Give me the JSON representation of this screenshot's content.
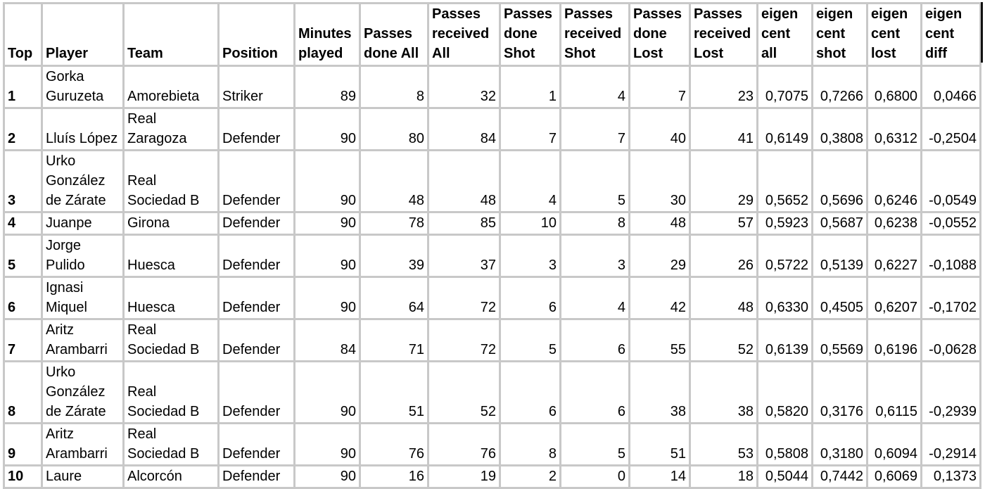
{
  "table": {
    "headers": [
      "Top",
      "Player",
      "Team",
      "Position",
      "Minutes played",
      "Passes done All",
      "Passes received All",
      "Passes done Shot",
      "Passes received Shot",
      "Passes done Lost",
      "Passes received Lost",
      "eigen cent all",
      "eigen cent shot",
      "eigen cent lost",
      "eigen cent diff"
    ],
    "rows": [
      [
        "1",
        "Gorka Guruzeta",
        "Amorebieta",
        "Striker",
        "89",
        "8",
        "32",
        "1",
        "4",
        "7",
        "23",
        "0,7075",
        "0,7266",
        "0,6800",
        "0,0466"
      ],
      [
        "2",
        "Lluís López",
        "Real Zaragoza",
        "Defender",
        "90",
        "80",
        "84",
        "7",
        "7",
        "40",
        "41",
        "0,6149",
        "0,3808",
        "0,6312",
        "-0,2504"
      ],
      [
        "3",
        "Urko González de Zárate",
        "Real Sociedad B",
        "Defender",
        "90",
        "48",
        "48",
        "4",
        "5",
        "30",
        "29",
        "0,5652",
        "0,5696",
        "0,6246",
        "-0,0549"
      ],
      [
        "4",
        "Juanpe",
        "Girona",
        "Defender",
        "90",
        "78",
        "85",
        "10",
        "8",
        "48",
        "57",
        "0,5923",
        "0,5687",
        "0,6238",
        "-0,0552"
      ],
      [
        "5",
        "Jorge Pulido",
        "Huesca",
        "Defender",
        "90",
        "39",
        "37",
        "3",
        "3",
        "29",
        "26",
        "0,5722",
        "0,5139",
        "0,6227",
        "-0,1088"
      ],
      [
        "6",
        "Ignasi Miquel",
        "Huesca",
        "Defender",
        "90",
        "64",
        "72",
        "6",
        "4",
        "42",
        "48",
        "0,6330",
        "0,4505",
        "0,6207",
        "-0,1702"
      ],
      [
        "7",
        "Aritz Arambarri",
        "Real Sociedad B",
        "Defender",
        "84",
        "71",
        "72",
        "5",
        "6",
        "55",
        "52",
        "0,6139",
        "0,5569",
        "0,6196",
        "-0,0628"
      ],
      [
        "8",
        "Urko González de Zárate",
        "Real Sociedad B",
        "Defender",
        "90",
        "51",
        "52",
        "6",
        "6",
        "38",
        "38",
        "0,5820",
        "0,3176",
        "0,6115",
        "-0,2939"
      ],
      [
        "9",
        "Aritz Arambarri",
        "Real Sociedad B",
        "Defender",
        "90",
        "76",
        "76",
        "8",
        "5",
        "51",
        "53",
        "0,5808",
        "0,3180",
        "0,6094",
        "-0,2914"
      ],
      [
        "10",
        "Laure",
        "Alcorcón",
        "Defender",
        "90",
        "16",
        "19",
        "2",
        "0",
        "14",
        "18",
        "0,5044",
        "0,7442",
        "0,6069",
        "0,1373"
      ]
    ]
  }
}
